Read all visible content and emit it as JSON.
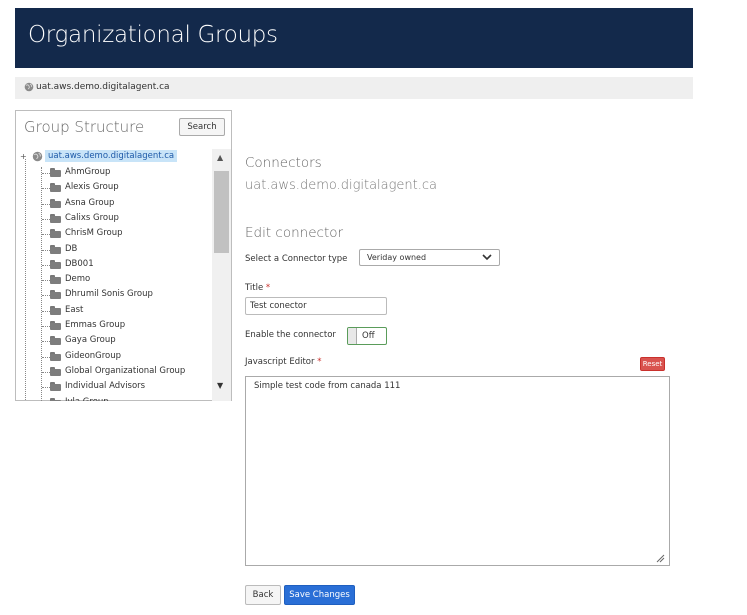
{
  "header": {
    "title": "Organizational Groups"
  },
  "breadcrumb": {
    "icon": "globe-icon",
    "text": "uat.aws.demo.digitalagent.ca"
  },
  "group_structure": {
    "title": "Group Structure",
    "search_label": "Search",
    "root": {
      "label": "uat.aws.demo.digitalagent.ca",
      "icon": "globe-icon"
    },
    "items": [
      {
        "label": "AhmGroup"
      },
      {
        "label": "Alexis Group"
      },
      {
        "label": "Asna Group"
      },
      {
        "label": "Calixs Group"
      },
      {
        "label": "ChrisM Group"
      },
      {
        "label": "DB"
      },
      {
        "label": "DB001"
      },
      {
        "label": "Demo"
      },
      {
        "label": "Dhrumil Sonis Group"
      },
      {
        "label": "East"
      },
      {
        "label": "Emmas Group"
      },
      {
        "label": "Gaya Group"
      },
      {
        "label": "GideonGroup"
      },
      {
        "label": "Global Organizational Group"
      },
      {
        "label": "Individual Advisors"
      },
      {
        "label": "Iyla Group"
      }
    ]
  },
  "connectors": {
    "heading": "Connectors",
    "site": "uat.aws.demo.digitalagent.ca",
    "edit_heading": "Edit connector",
    "type_label": "Select a Connector type",
    "type_value": "Veriday owned",
    "title_label": "Title",
    "title_value": "Test conector",
    "enable_label": "Enable the connector",
    "toggle_state": "Off",
    "editor_label": "Javascript Editor",
    "reset_label": "Reset",
    "editor_value": "Simple test code from canada 111",
    "required_mark": "*"
  },
  "actions": {
    "back_label": "Back",
    "save_label": "Save Changes"
  },
  "colors": {
    "header_bg": "#13294b",
    "save_button": "#2a6fd6",
    "reset_button": "#d9534f",
    "toggle_border": "#5a9c5a",
    "selected_node": "#c8e4f8"
  }
}
